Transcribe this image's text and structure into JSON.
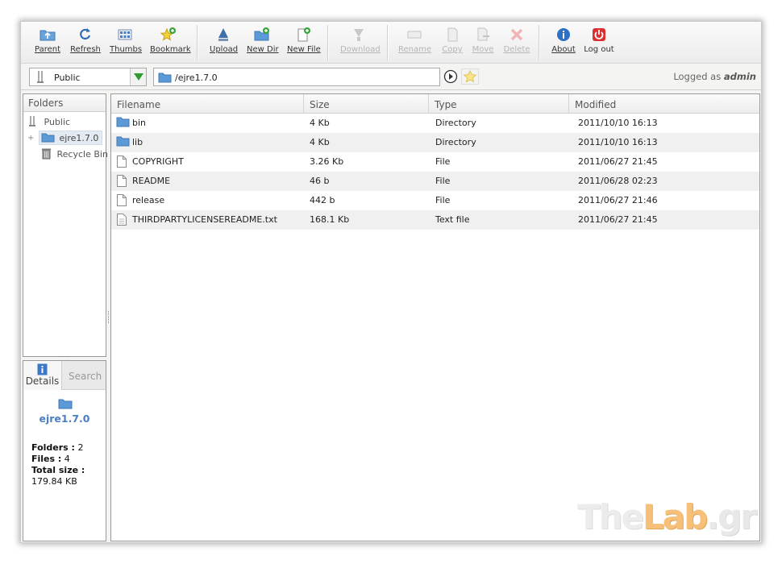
{
  "toolbar": {
    "parent": "Parent",
    "refresh": "Refresh",
    "thumbs": "Thumbs",
    "bookmark": "Bookmark",
    "upload": "Upload",
    "new_dir": "New Dir",
    "new_file": "New File",
    "download": "Download",
    "rename": "Rename",
    "copy": "Copy",
    "move": "Move",
    "delete": "Delete",
    "about": "About",
    "logout": "Log out"
  },
  "address": {
    "source": "Public",
    "path": "/ejre1.7.0"
  },
  "session": {
    "logged_prefix": "Logged as",
    "user": "admin"
  },
  "folders_panel": {
    "title": "Folders",
    "root": "Public",
    "selected": "ejre1.7.0",
    "recycle": "Recycle Bin",
    "expander": "+"
  },
  "details_panel": {
    "tab_details": "Details",
    "tab_search": "Search",
    "name": "ejre1.7.0",
    "folders_label": "Folders :",
    "folders_value": "2",
    "files_label": "Files :",
    "files_value": "4",
    "total_label": "Total size :",
    "total_value": "179.84 KB"
  },
  "file_list": {
    "columns": [
      "Filename",
      "Size",
      "Type",
      "Modified"
    ],
    "rows": [
      {
        "name": "bin",
        "size": "4 Kb",
        "type": "Directory",
        "modified": "2011/10/10 16:13",
        "kind": "folder"
      },
      {
        "name": "lib",
        "size": "4 Kb",
        "type": "Directory",
        "modified": "2011/10/10 16:13",
        "kind": "folder"
      },
      {
        "name": "COPYRIGHT",
        "size": "3.26 Kb",
        "type": "File",
        "modified": "2011/06/27 21:45",
        "kind": "file"
      },
      {
        "name": "README",
        "size": "46 b",
        "type": "File",
        "modified": "2011/06/28 02:23",
        "kind": "file"
      },
      {
        "name": "release",
        "size": "442 b",
        "type": "File",
        "modified": "2011/06/27 21:46",
        "kind": "file"
      },
      {
        "name": "THIRDPARTYLICENSEREADME.txt",
        "size": "168.1 Kb",
        "type": "Text file",
        "modified": "2011/06/27 21:45",
        "kind": "text-file"
      }
    ]
  },
  "watermark": {
    "the": "The",
    "lab": "Lab",
    "gr": ".gr"
  },
  "colors": {
    "folder": "#5b9ad6",
    "accent": "#4a7fc1",
    "selected_row": "#e4eaf2"
  }
}
